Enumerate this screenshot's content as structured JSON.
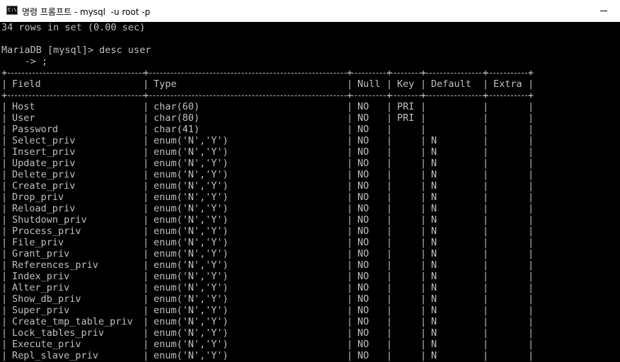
{
  "window": {
    "title": "명령 프롬프트 - mysql  -u root -p",
    "icon_label": "C:\\",
    "icon": "console-icon",
    "minimize_icon": "minimize-icon"
  },
  "console": {
    "result_summary": "34 rows in set (0.00 sec)",
    "prompt": "MariaDB [mysql]> desc user",
    "continuation": "    -> ;",
    "headers": [
      "Field",
      "Type",
      "Null",
      "Key",
      "Default",
      "Extra"
    ],
    "rows": [
      {
        "field": "Host",
        "type": "char(60)",
        "null": "NO",
        "key": "PRI",
        "default": "",
        "extra": ""
      },
      {
        "field": "User",
        "type": "char(80)",
        "null": "NO",
        "key": "PRI",
        "default": "",
        "extra": ""
      },
      {
        "field": "Password",
        "type": "char(41)",
        "null": "NO",
        "key": "",
        "default": "",
        "extra": ""
      },
      {
        "field": "Select_priv",
        "type": "enum('N','Y')",
        "null": "NO",
        "key": "",
        "default": "N",
        "extra": ""
      },
      {
        "field": "Insert_priv",
        "type": "enum('N','Y')",
        "null": "NO",
        "key": "",
        "default": "N",
        "extra": ""
      },
      {
        "field": "Update_priv",
        "type": "enum('N','Y')",
        "null": "NO",
        "key": "",
        "default": "N",
        "extra": ""
      },
      {
        "field": "Delete_priv",
        "type": "enum('N','Y')",
        "null": "NO",
        "key": "",
        "default": "N",
        "extra": ""
      },
      {
        "field": "Create_priv",
        "type": "enum('N','Y')",
        "null": "NO",
        "key": "",
        "default": "N",
        "extra": ""
      },
      {
        "field": "Drop_priv",
        "type": "enum('N','Y')",
        "null": "NO",
        "key": "",
        "default": "N",
        "extra": ""
      },
      {
        "field": "Reload_priv",
        "type": "enum('N','Y')",
        "null": "NO",
        "key": "",
        "default": "N",
        "extra": ""
      },
      {
        "field": "Shutdown_priv",
        "type": "enum('N','Y')",
        "null": "NO",
        "key": "",
        "default": "N",
        "extra": ""
      },
      {
        "field": "Process_priv",
        "type": "enum('N','Y')",
        "null": "NO",
        "key": "",
        "default": "N",
        "extra": ""
      },
      {
        "field": "File_priv",
        "type": "enum('N','Y')",
        "null": "NO",
        "key": "",
        "default": "N",
        "extra": ""
      },
      {
        "field": "Grant_priv",
        "type": "enum('N','Y')",
        "null": "NO",
        "key": "",
        "default": "N",
        "extra": ""
      },
      {
        "field": "References_priv",
        "type": "enum('N','Y')",
        "null": "NO",
        "key": "",
        "default": "N",
        "extra": ""
      },
      {
        "field": "Index_priv",
        "type": "enum('N','Y')",
        "null": "NO",
        "key": "",
        "default": "N",
        "extra": ""
      },
      {
        "field": "Alter_priv",
        "type": "enum('N','Y')",
        "null": "NO",
        "key": "",
        "default": "N",
        "extra": ""
      },
      {
        "field": "Show_db_priv",
        "type": "enum('N','Y')",
        "null": "NO",
        "key": "",
        "default": "N",
        "extra": ""
      },
      {
        "field": "Super_priv",
        "type": "enum('N','Y')",
        "null": "NO",
        "key": "",
        "default": "N",
        "extra": ""
      },
      {
        "field": "Create_tmp_table_priv",
        "type": "enum('N','Y')",
        "null": "NO",
        "key": "",
        "default": "N",
        "extra": ""
      },
      {
        "field": "Lock_tables_priv",
        "type": "enum('N','Y')",
        "null": "NO",
        "key": "",
        "default": "N",
        "extra": ""
      },
      {
        "field": "Execute_priv",
        "type": "enum('N','Y')",
        "null": "NO",
        "key": "",
        "default": "N",
        "extra": ""
      },
      {
        "field": "Repl_slave_priv",
        "type": "enum('N','Y')",
        "null": "NO",
        "key": "",
        "default": "N",
        "extra": ""
      }
    ]
  },
  "colors": {
    "console_background": "#000000",
    "console_text": "#c0c0c0",
    "titlebar_background": "#ffffff"
  }
}
